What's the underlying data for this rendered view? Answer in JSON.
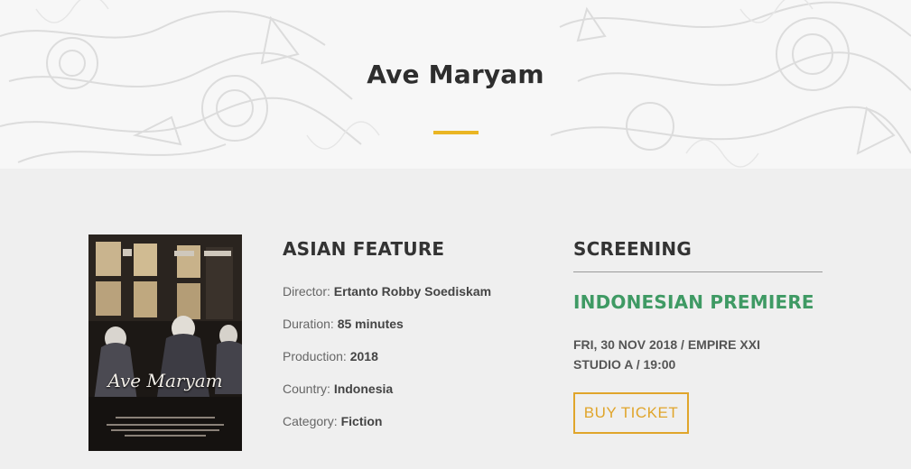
{
  "page": {
    "title": "Ave Maryam",
    "accent_color": "#eab523"
  },
  "poster": {
    "title_text": "Ave Maryam",
    "alt": "Ave Maryam poster"
  },
  "info": {
    "heading": "ASIAN FEATURE",
    "rows": [
      {
        "label": "Director: ",
        "value": "Ertanto Robby Soediskam"
      },
      {
        "label": "Duration: ",
        "value": "85 minutes"
      },
      {
        "label": "Production: ",
        "value": "2018"
      },
      {
        "label": "Country: ",
        "value": "Indonesia"
      },
      {
        "label": "Category: ",
        "value": "Fiction"
      }
    ]
  },
  "screening": {
    "heading": "SCREENING",
    "premiere": "INDONESIAN PREMIERE",
    "premiere_color": "#3f9a64",
    "schedule": "FRI, 30 NOV 2018 / EMPIRE XXI STUDIO A / 19:00",
    "button_label": "BUY TICKET",
    "button_color": "#e0a52b"
  }
}
